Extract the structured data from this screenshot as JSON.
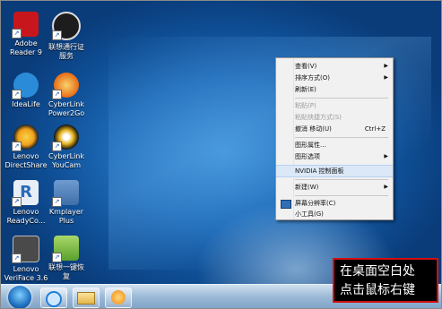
{
  "desktop_icons": [
    {
      "label1": "Adobe",
      "label2": "Reader 9",
      "color": "#c8161d"
    },
    {
      "label1": "联想通行证",
      "label2": "服务",
      "color": "#1d1d1d"
    },
    {
      "label1": "IdeaLife",
      "label2": "",
      "color": "#2a8cd8"
    },
    {
      "label1": "CyberLink",
      "label2": "Power2Go",
      "color": "#e96b16"
    },
    {
      "label1": "Lenovo",
      "label2": "DirectShare",
      "color": "#f2a11a"
    },
    {
      "label1": "CyberLink",
      "label2": "YouCam",
      "color": "#e3b21d"
    },
    {
      "label1": "Lenovo",
      "label2": "ReadyCo...",
      "color": "#e8eef6"
    },
    {
      "label1": "Kmplayer",
      "label2": "Plus",
      "color": "#3f6fa8"
    },
    {
      "label1": "Lenovo",
      "label2": "VeriFace 3.6",
      "color": "#4a4a4a"
    },
    {
      "label1": "联想一键恢",
      "label2": "复",
      "color": "#5aa02c"
    }
  ],
  "context_menu": {
    "items": [
      {
        "label": "查看(V)",
        "shortcut": "",
        "arrow": "▶",
        "disabled": false
      },
      {
        "label": "排序方式(O)",
        "shortcut": "",
        "arrow": "▶",
        "disabled": false
      },
      {
        "label": "刷新(E)",
        "shortcut": "",
        "arrow": "",
        "disabled": false
      },
      {
        "label": "粘贴(P)",
        "shortcut": "",
        "arrow": "",
        "disabled": true
      },
      {
        "label": "粘贴快捷方式(S)",
        "shortcut": "",
        "arrow": "",
        "disabled": true
      },
      {
        "label": "撤消 移动(U)",
        "shortcut": "Ctrl+Z",
        "arrow": "",
        "disabled": false
      },
      {
        "label": "图形属性...",
        "shortcut": "",
        "arrow": "",
        "disabled": false
      },
      {
        "label": "图形选项",
        "shortcut": "",
        "arrow": "▶",
        "disabled": false
      },
      {
        "label": "NVIDIA 控制面板",
        "shortcut": "",
        "arrow": "",
        "disabled": false
      },
      {
        "label": "新建(W)",
        "shortcut": "",
        "arrow": "▶",
        "disabled": false
      },
      {
        "label": "屏幕分辨率(C)",
        "shortcut": "",
        "arrow": "",
        "disabled": false
      },
      {
        "label": "小工具(G)",
        "shortcut": "",
        "arrow": "",
        "disabled": false
      }
    ]
  },
  "annotation": {
    "line1": "在桌面空白处",
    "line2": "点击鼠标右键"
  },
  "colors": {
    "annotation_border": "#d20f0f",
    "wallpaper": "#1e6bb8"
  }
}
